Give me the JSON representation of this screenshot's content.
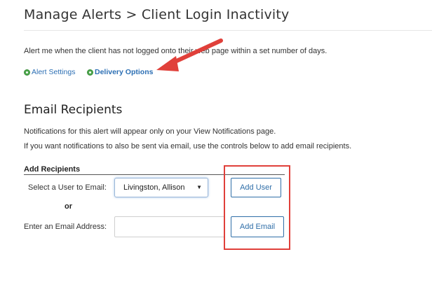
{
  "header": {
    "title": "Manage Alerts > Client Login Inactivity",
    "description": "Alert me when the client has not logged onto their web page within a set number of days."
  },
  "tabs": [
    {
      "label": "Alert Settings"
    },
    {
      "label": "Delivery Options"
    }
  ],
  "email_recipients": {
    "title": "Email Recipients",
    "note_1": "Notifications for this alert will appear only on your View Notifications page.",
    "note_2": "If you want notifications to also be sent via email, use the controls below to add email recipients.",
    "add_recipients_title": "Add Recipients",
    "select_user_label": "Select a User to Email:",
    "selected_user": "Livingston, Allison",
    "add_user_button": "Add User",
    "or_label": "or",
    "email_label": "Enter an Email Address:",
    "email_value": "",
    "add_email_button": "Add Email"
  },
  "annotations": {
    "arrow_color": "#e0403a",
    "box_color": "#e0403a"
  },
  "colors": {
    "link": "#2c6fb4",
    "status_dot": "#4ca64c"
  }
}
